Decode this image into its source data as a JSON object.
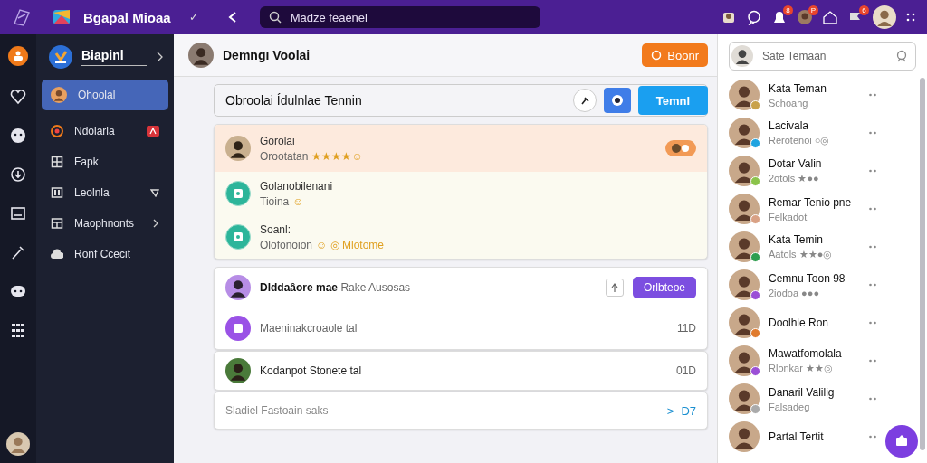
{
  "topbar": {
    "app_title": "Bgapal Mioaa",
    "check": "✓",
    "search": {
      "value": "Madze feaenel"
    },
    "badges": [
      "8",
      "P",
      "6"
    ]
  },
  "nav": {
    "title": "Biapinl",
    "items": [
      {
        "label": "Ohoolal",
        "selected": true,
        "kind": "avatar"
      },
      {
        "label": "Ndoiarla",
        "selected": false,
        "kind": "alert"
      },
      {
        "label": "Fapk",
        "selected": false,
        "kind": "grid"
      },
      {
        "label": "Leolnla",
        "selected": false,
        "kind": "tag"
      },
      {
        "label": "Maophnonts",
        "selected": false,
        "kind": "submenu"
      },
      {
        "label": "Ronf Ccecit",
        "selected": false,
        "kind": "cloud"
      }
    ]
  },
  "chat": {
    "title": "Demngı Voolai",
    "action": "Boonr",
    "composer": {
      "value": "Obroolai Ídulnlae Tennin",
      "send": "Temnl"
    },
    "feed": [
      {
        "kind": "person",
        "name": "Gorolai",
        "text": "Orootatan",
        "reactions": "★★★★☺",
        "selected": true
      },
      {
        "kind": "bot",
        "name": "Golanobilenani",
        "text": "Tioina",
        "reactions": "☺",
        "selected": false
      },
      {
        "kind": "bot",
        "name": "Soanl:",
        "text": "Olofonoion",
        "reactions": "☺ ◎ Mlotome",
        "selected": false
      }
    ],
    "threads": [
      {
        "kind": "group",
        "title": "**Dlddaâore mae** Rake Ausosas",
        "button": "Orlbteoe",
        "sub": "Maeninakcroaole tal",
        "time": "11D"
      },
      {
        "kind": "single",
        "title": "Kodanpot Stonete tal",
        "time": "01D"
      },
      {
        "kind": "link",
        "title": "Sladiel Fastoain saks",
        "chevron": ">",
        "time": "D7"
      }
    ]
  },
  "friends": {
    "search": {
      "placeholder": "Sate Temaan"
    },
    "items": [
      {
        "name": "Kata Teman",
        "status": "Schoang",
        "color": "#c9a24a"
      },
      {
        "name": "Lacivala",
        "status": "Rerotenoi ○◎",
        "color": "#1fa3e0"
      },
      {
        "name": "Dotar Valin",
        "status": "2otols ★●●",
        "color": "#8bc34a"
      },
      {
        "name": "Remar Tenio pne",
        "status": "Felkadot",
        "color": "#d9a184"
      },
      {
        "name": "Kata Temin",
        "status": "Aatols ★★●◎",
        "color": "#2e9e4f"
      },
      {
        "name": "Cemnu Toon 98",
        "status": "2iodoa ●●●",
        "color": "#9b4fd6"
      },
      {
        "name": "Doolhle Ron",
        "color": "#e07b2e"
      },
      {
        "name": "Mawatfomolala",
        "status": "Rlonkar ★★◎",
        "color": "#9b4fd6"
      },
      {
        "name": "Danaril Valilig",
        "status": "Falsadeg",
        "color": "#aaaaaa"
      },
      {
        "name": "Partal Tertit"
      }
    ]
  }
}
